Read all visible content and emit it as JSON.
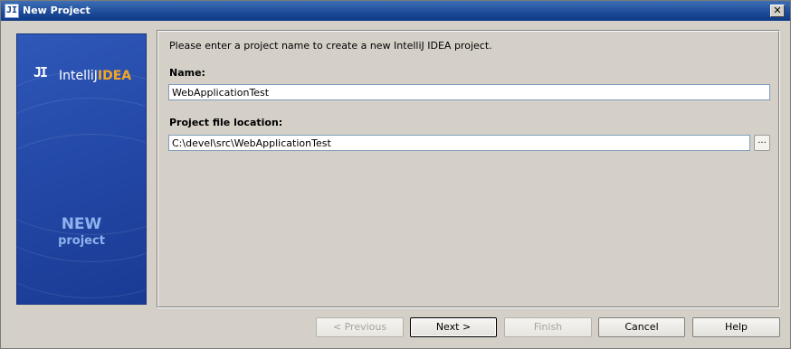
{
  "window": {
    "title": "New Project",
    "icon": "intellij-app-icon",
    "close_label": "✕"
  },
  "banner": {
    "logo_mark": "JI",
    "logo_name_primary": "IntelliJ",
    "logo_name_accent": "IDEA",
    "line1": "NEW",
    "line2": "project"
  },
  "form": {
    "intro": "Please enter a project name to create a new IntelliJ IDEA project.",
    "name_label": "Name:",
    "name_value": "WebApplicationTest",
    "location_label": "Project file location:",
    "location_value": "C:\\devel\\src\\WebApplicationTest",
    "browse_label": "..."
  },
  "buttons": {
    "previous": "< Previous",
    "next": "Next >",
    "finish": "Finish",
    "cancel": "Cancel",
    "help": "Help"
  },
  "colors": {
    "titlebar": "#1d4a96",
    "banner": "#2449a8",
    "accent": "#f5a623",
    "dialog": "#d4d0c8"
  }
}
